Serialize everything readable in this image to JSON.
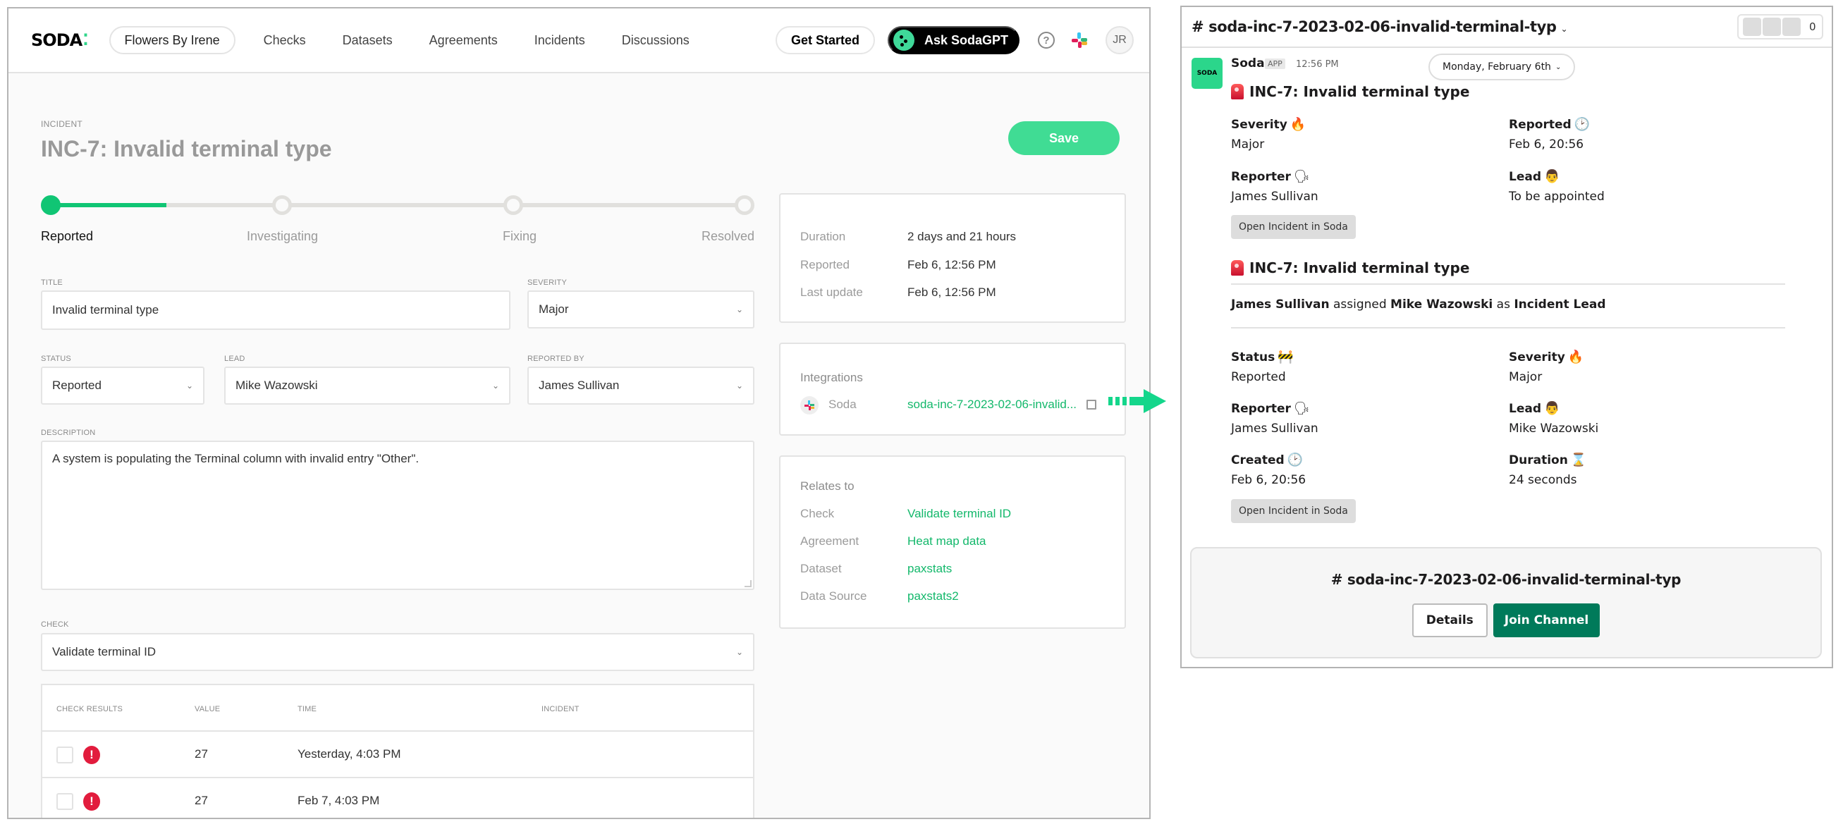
{
  "soda": {
    "logo": "SODA",
    "org": "Flowers By Irene",
    "nav": [
      "Checks",
      "Datasets",
      "Agreements",
      "Incidents",
      "Discussions"
    ],
    "get_started": "Get Started",
    "ask_gpt": "Ask SodaGPT",
    "help": "?",
    "avatar_initials": "JR",
    "incident_label": "INCIDENT",
    "incident_title": "INC-7: Invalid terminal type",
    "save": "Save",
    "stepper": {
      "steps": [
        "Reported",
        "Investigating",
        "Fixing",
        "Resolved"
      ],
      "active_index": 0,
      "progress_fraction": 0.167
    },
    "form": {
      "title_label": "TITLE",
      "title_value": "Invalid terminal type",
      "severity_label": "SEVERITY",
      "severity_value": "Major",
      "status_label": "STATUS",
      "status_value": "Reported",
      "lead_label": "LEAD",
      "lead_value": "Mike Wazowski",
      "reported_by_label": "REPORTED BY",
      "reported_by_value": "James Sullivan",
      "description_label": "DESCRIPTION",
      "description_value": "A system is populating the Terminal column with invalid entry \"Other\".",
      "check_label": "CHECK",
      "check_value": "Validate terminal ID"
    },
    "results": {
      "headers": [
        "CHECK RESULTS",
        "VALUE",
        "TIME",
        "INCIDENT"
      ],
      "rows": [
        {
          "status": "fail",
          "value": "27",
          "time": "Yesterday, 4:03 PM",
          "incident": ""
        },
        {
          "status": "fail",
          "value": "27",
          "time": "Feb 7, 4:03 PM",
          "incident": ""
        }
      ]
    },
    "summary": {
      "duration_label": "Duration",
      "duration_value": "2 days and 21 hours",
      "reported_label": "Reported",
      "reported_value": "Feb 6, 12:56 PM",
      "updated_label": "Last update",
      "updated_value": "Feb 6, 12:56 PM"
    },
    "integrations": {
      "title": "Integrations",
      "name": "Soda",
      "link": "soda-inc-7-2023-02-06-invalid..."
    },
    "relates": {
      "title": "Relates to",
      "items": [
        {
          "label": "Check",
          "value": "Validate terminal ID"
        },
        {
          "label": "Agreement",
          "value": "Heat map data"
        },
        {
          "label": "Dataset",
          "value": "paxstats"
        },
        {
          "label": "Data Source",
          "value": "paxstats2"
        }
      ]
    },
    "colors": {
      "accent": "#10c574",
      "save": "#40dc94",
      "fail": "#e21c3d",
      "arrow": "#14d68b"
    }
  },
  "slack": {
    "channel": "# soda-inc-7-2023-02-06-invalid-terminal-typ",
    "member_count": "0",
    "avatar_text": "SODA",
    "sender": "Soda",
    "app_badge": "APP",
    "time": "12:56 PM",
    "date_pill": "Monday, February 6th",
    "msg1": {
      "title": "INC-7: Invalid terminal type",
      "severity_label": "Severity",
      "severity_emoji": "🔥",
      "severity_value": "Major",
      "reported_label": "Reported",
      "reported_emoji": "🕑",
      "reported_value": "Feb 6, 20:56",
      "reporter_label": "Reporter",
      "reporter_emoji": "🗣",
      "reporter_value": "James Sullivan",
      "lead_label": "Lead",
      "lead_emoji": "👨",
      "lead_value": "To be appointed",
      "button": "Open Incident in Soda"
    },
    "msg2": {
      "title": "INC-7: Invalid terminal type",
      "assign_actor": "James Sullivan",
      "assign_verb": " assigned ",
      "assign_target": "Mike Wazowski",
      "assign_as": " as ",
      "assign_role": "Incident Lead",
      "status_label": "Status",
      "status_emoji": "🚧",
      "status_value": "Reported",
      "severity_label": "Severity",
      "severity_emoji": "🔥",
      "severity_value": "Major",
      "reporter_label": "Reporter",
      "reporter_emoji": "🗣",
      "reporter_value": "James Sullivan",
      "lead_label": "Lead",
      "lead_emoji": "👨",
      "lead_value": "Mike Wazowski",
      "created_label": "Created",
      "created_emoji": "🕑",
      "created_value": "Feb 6, 20:56",
      "duration_label": "Duration",
      "duration_emoji": "⌛",
      "duration_value": "24 seconds",
      "button": "Open Incident in Soda"
    },
    "join": {
      "channel": "# soda-inc-7-2023-02-06-invalid-terminal-typ",
      "details": "Details",
      "join": "Join Channel"
    }
  }
}
